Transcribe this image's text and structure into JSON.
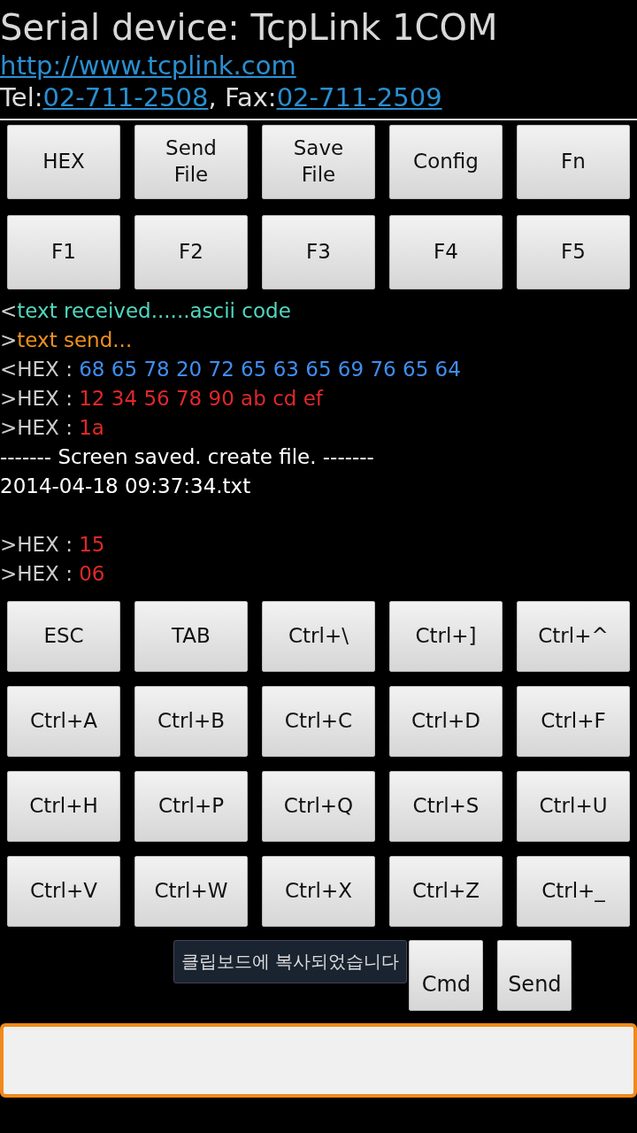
{
  "header": {
    "title": "Serial device: TcpLink 1COM",
    "url": "http://www.tcplink.com",
    "contact": [
      {
        "kind": "text",
        "text": "Tel:"
      },
      {
        "kind": "link",
        "text": "02-711-2508"
      },
      {
        "kind": "text",
        "text": ", Fax:"
      },
      {
        "kind": "link",
        "text": "02-711-2509"
      }
    ]
  },
  "top_buttons": [
    "HEX",
    "Send\nFile",
    "Save\nFile",
    "Config",
    "Fn",
    "F1",
    "F2",
    "F3",
    "F4",
    "F5"
  ],
  "log": [
    {
      "prefix": "<",
      "text": "text received......ascii code",
      "kind": "received"
    },
    {
      "prefix": ">",
      "text": "text send...",
      "kind": "sent"
    },
    {
      "prefix": "<HEX : ",
      "text": "68 65 78 20 72 65 63 65 69 76 65 64",
      "kind": "hex_in"
    },
    {
      "prefix": ">HEX : ",
      "text": "12 34 56 78 90 ab cd ef",
      "kind": "hex_out"
    },
    {
      "prefix": ">HEX : ",
      "text": "1a",
      "kind": "hex_out"
    },
    {
      "text": "------- Screen saved. create file. -------",
      "kind": "plain"
    },
    {
      "text": "2014-04-18 09:37:34.txt",
      "kind": "plain"
    },
    {
      "kind": "blank"
    },
    {
      "prefix": ">HEX : ",
      "text": "15",
      "kind": "hex_out"
    },
    {
      "prefix": ">HEX : ",
      "text": "06",
      "kind": "hex_out"
    }
  ],
  "key_buttons": [
    "ESC",
    "TAB",
    "Ctrl+\\",
    "Ctrl+]",
    "Ctrl+^",
    "Ctrl+A",
    "Ctrl+B",
    "Ctrl+C",
    "Ctrl+D",
    "Ctrl+F",
    "Ctrl+H",
    "Ctrl+P",
    "Ctrl+Q",
    "Ctrl+S",
    "Ctrl+U",
    "Ctrl+V",
    "Ctrl+W",
    "Ctrl+X",
    "Ctrl+Z",
    "Ctrl+_"
  ],
  "toast": "클립보드에 복사되었습니다",
  "bottom_buttons": [
    "Cmd",
    "Send"
  ]
}
